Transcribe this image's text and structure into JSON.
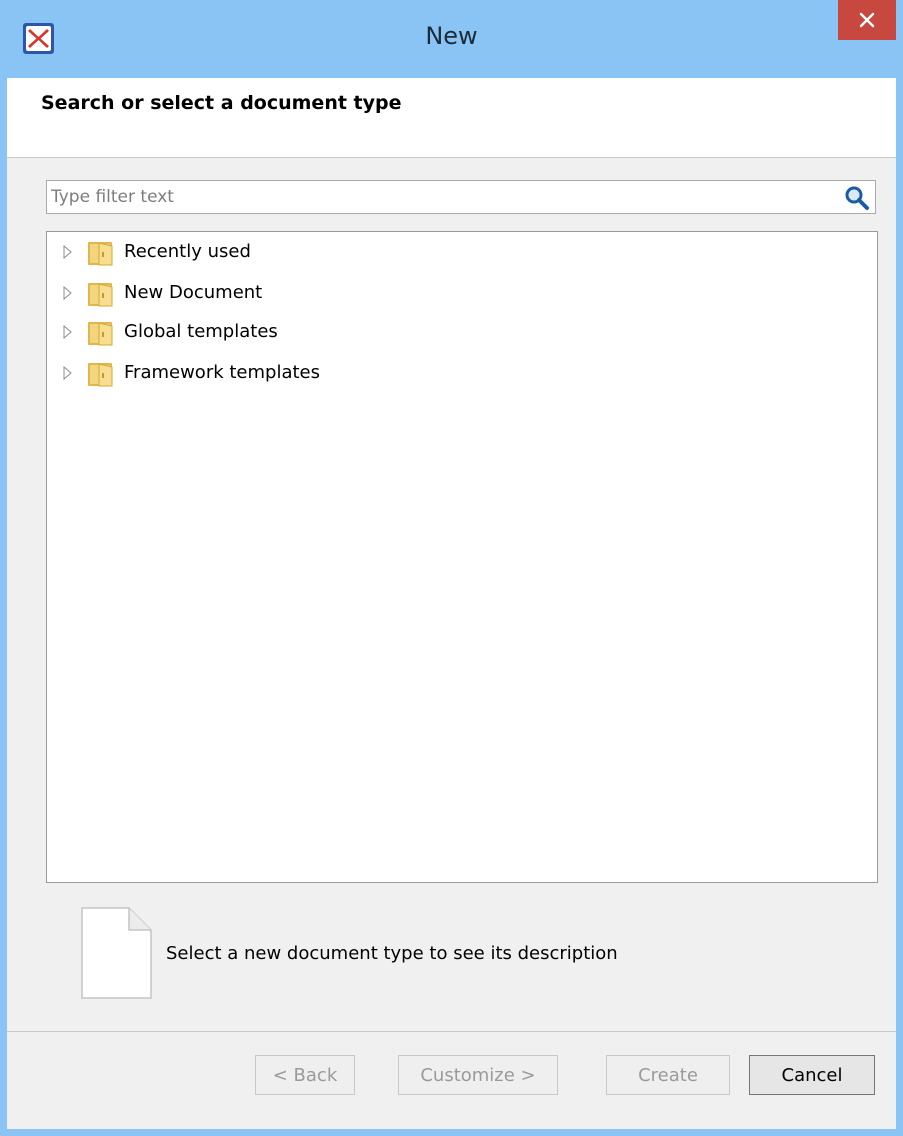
{
  "window": {
    "title": "New",
    "close_glyph": "✕",
    "app_icon": "oxygen-app-icon",
    "colors": {
      "titlebar": "#8ac4f4",
      "close": "#c7483f"
    }
  },
  "header": {
    "title": "Search or select a document type"
  },
  "filter": {
    "placeholder": "Type filter text",
    "value": "",
    "icon": "search-icon"
  },
  "tree": {
    "items": [
      {
        "label": "Recently used",
        "icon": "folder-icon",
        "expanded": false
      },
      {
        "label": "New Document",
        "icon": "folder-icon",
        "expanded": false
      },
      {
        "label": "Global templates",
        "icon": "folder-icon",
        "expanded": false
      },
      {
        "label": "Framework templates",
        "icon": "folder-icon",
        "expanded": false
      }
    ]
  },
  "description": {
    "icon": "document-icon",
    "text": "Select a new document type to see its description"
  },
  "buttons": {
    "back": "< Back",
    "customize": "Customize >",
    "create": "Create",
    "cancel": "Cancel"
  }
}
